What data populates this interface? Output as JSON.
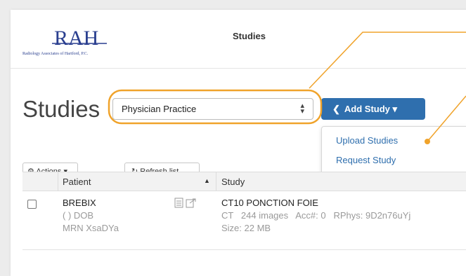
{
  "header": {
    "logo_text": "RAH",
    "logo_subtext": "Radiology Associates of Hartford, P.C.",
    "nav_link": "Studies"
  },
  "page": {
    "title": "Studies"
  },
  "practice_select": {
    "value": "Physician Practice"
  },
  "add_study": {
    "label": "Add Study"
  },
  "dropdown": {
    "items": [
      "Upload Studies",
      "Request Study"
    ]
  },
  "toolbar": {
    "actions_label": "Actions",
    "refresh_label": "Refresh list"
  },
  "table": {
    "columns": [
      "Patient",
      "Study"
    ],
    "rows": [
      {
        "patient_name": "BREBIX",
        "patient_dob": "( ) DOB",
        "patient_mrn": "MRN XsaDYa",
        "study_name": "CT10 PONCTION FOIE",
        "study_details": "CT   244 images   Acc#: 0   RPhys: 9D2n76uYj",
        "study_size": "Size: 22 MB"
      }
    ]
  },
  "colors": {
    "accent_blue": "#2f6fae",
    "highlight_orange": "#f0a32b"
  }
}
